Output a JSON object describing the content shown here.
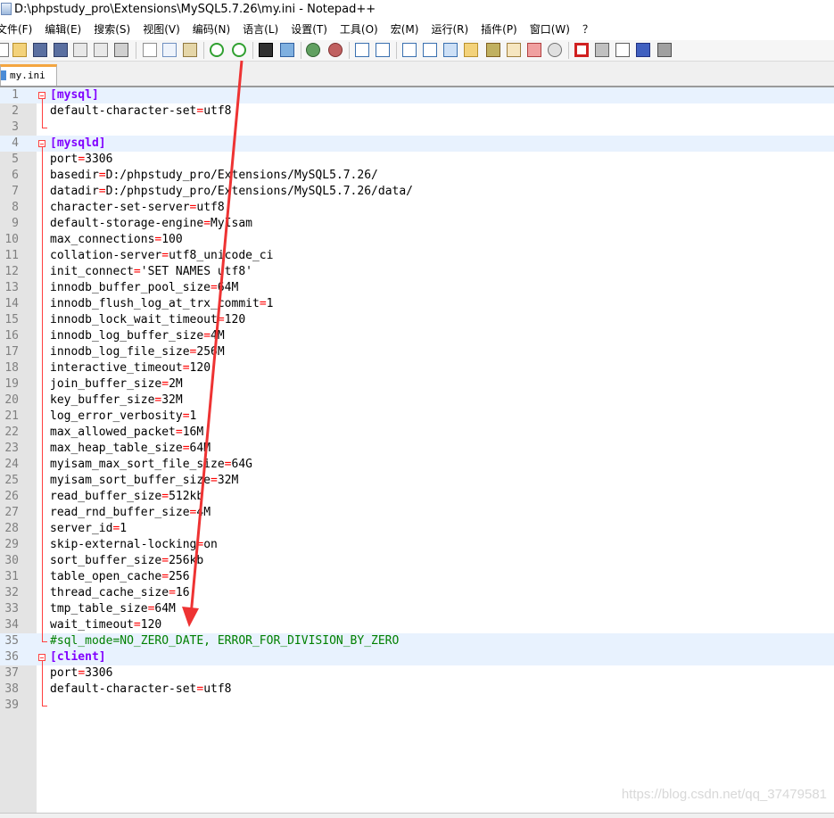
{
  "window": {
    "title": "D:\\phpstudy_pro\\Extensions\\MySQL5.7.26\\my.ini - Notepad++"
  },
  "menu": [
    "文件(F)",
    "编辑(E)",
    "搜索(S)",
    "视图(V)",
    "编码(N)",
    "语言(L)",
    "设置(T)",
    "工具(O)",
    "宏(M)",
    "运行(R)",
    "插件(P)",
    "窗口(W)",
    "？"
  ],
  "tab": {
    "label": "my.ini",
    "close_glyph": "✕"
  },
  "lines": [
    {
      "n": "1",
      "type": "section",
      "text": "[mysql]"
    },
    {
      "n": "2",
      "type": "kv",
      "key": "default-character-set",
      "value": "utf8"
    },
    {
      "n": "3",
      "type": "empty"
    },
    {
      "n": "4",
      "type": "section",
      "text": "[mysqld]"
    },
    {
      "n": "5",
      "type": "kv",
      "key": "port",
      "value": "3306"
    },
    {
      "n": "6",
      "type": "kv",
      "key": "basedir",
      "value": "D:/phpstudy_pro/Extensions/MySQL5.7.26/"
    },
    {
      "n": "7",
      "type": "kv",
      "key": "datadir",
      "value": "D:/phpstudy_pro/Extensions/MySQL5.7.26/data/"
    },
    {
      "n": "8",
      "type": "kv",
      "key": "character-set-server",
      "value": "utf8"
    },
    {
      "n": "9",
      "type": "kv",
      "key": "default-storage-engine",
      "value": "MyIsam"
    },
    {
      "n": "10",
      "type": "kv",
      "key": "max_connections",
      "value": "100"
    },
    {
      "n": "11",
      "type": "kv",
      "key": "collation-server",
      "value": "utf8_unicode_ci"
    },
    {
      "n": "12",
      "type": "kv",
      "key": "init_connect",
      "value": "'SET NAMES utf8'"
    },
    {
      "n": "13",
      "type": "kv",
      "key": "innodb_buffer_pool_size",
      "value": "64M"
    },
    {
      "n": "14",
      "type": "kv",
      "key": "innodb_flush_log_at_trx_commit",
      "value": "1"
    },
    {
      "n": "15",
      "type": "kv",
      "key": "innodb_lock_wait_timeout",
      "value": "120"
    },
    {
      "n": "16",
      "type": "kv",
      "key": "innodb_log_buffer_size",
      "value": "4M"
    },
    {
      "n": "17",
      "type": "kv",
      "key": "innodb_log_file_size",
      "value": "256M"
    },
    {
      "n": "18",
      "type": "kv",
      "key": "interactive_timeout",
      "value": "120"
    },
    {
      "n": "19",
      "type": "kv",
      "key": "join_buffer_size",
      "value": "2M"
    },
    {
      "n": "20",
      "type": "kv",
      "key": "key_buffer_size",
      "value": "32M"
    },
    {
      "n": "21",
      "type": "kv",
      "key": "log_error_verbosity",
      "value": "1"
    },
    {
      "n": "22",
      "type": "kv",
      "key": "max_allowed_packet",
      "value": "16M"
    },
    {
      "n": "23",
      "type": "kv",
      "key": "max_heap_table_size",
      "value": "64M"
    },
    {
      "n": "24",
      "type": "kv",
      "key": "myisam_max_sort_file_size",
      "value": "64G"
    },
    {
      "n": "25",
      "type": "kv",
      "key": "myisam_sort_buffer_size",
      "value": "32M"
    },
    {
      "n": "26",
      "type": "kv",
      "key": "read_buffer_size",
      "value": "512kb"
    },
    {
      "n": "27",
      "type": "kv",
      "key": "read_rnd_buffer_size",
      "value": "4M"
    },
    {
      "n": "28",
      "type": "kv",
      "key": "server_id",
      "value": "1"
    },
    {
      "n": "29",
      "type": "kv",
      "key": "skip-external-locking",
      "value": "on"
    },
    {
      "n": "30",
      "type": "kv",
      "key": "sort_buffer_size",
      "value": "256kb"
    },
    {
      "n": "31",
      "type": "kv",
      "key": "table_open_cache",
      "value": "256"
    },
    {
      "n": "32",
      "type": "kv",
      "key": "thread_cache_size",
      "value": "16"
    },
    {
      "n": "33",
      "type": "kv",
      "key": "tmp_table_size",
      "value": "64M"
    },
    {
      "n": "34",
      "type": "kv",
      "key": "wait_timeout",
      "value": "120"
    },
    {
      "n": "35",
      "type": "comment",
      "text": "#sql_mode=NO_ZERO_DATE, ERROR_FOR_DIVISION_BY_ZERO",
      "highlight": true
    },
    {
      "n": "36",
      "type": "section",
      "text": "[client]"
    },
    {
      "n": "37",
      "type": "kv",
      "key": "port",
      "value": "3306"
    },
    {
      "n": "38",
      "type": "kv",
      "key": "default-character-set",
      "value": "utf8"
    },
    {
      "n": "39",
      "type": "empty"
    }
  ],
  "watermark": "https://blog.csdn.net/qq_37479581",
  "colors": {
    "section": "#8000ff",
    "equals": "#ff0000",
    "comment": "#008000",
    "annotation_arrow": "#ee3333",
    "current_line": "#e8f2fe"
  },
  "toolbar_icons": [
    "new-file-icon",
    "open-file-icon",
    "save-icon",
    "save-all-icon",
    "close-icon",
    "close-all-icon",
    "print-icon",
    "cut-icon",
    "copy-icon",
    "paste-icon",
    "undo-icon",
    "redo-icon",
    "find-icon",
    "replace-icon",
    "zoom-in-icon",
    "zoom-out-icon",
    "sync-vertical-icon",
    "sync-horizontal-icon",
    "word-wrap-icon",
    "show-all-chars-icon",
    "indent-guide-icon",
    "user-lang-icon",
    "doc-map-icon",
    "function-list-icon",
    "folder-workspace-icon",
    "monitoring-icon",
    "record-macro-icon",
    "stop-macro-icon",
    "play-macro-icon",
    "run-macro-multiple-icon",
    "save-macro-icon"
  ]
}
